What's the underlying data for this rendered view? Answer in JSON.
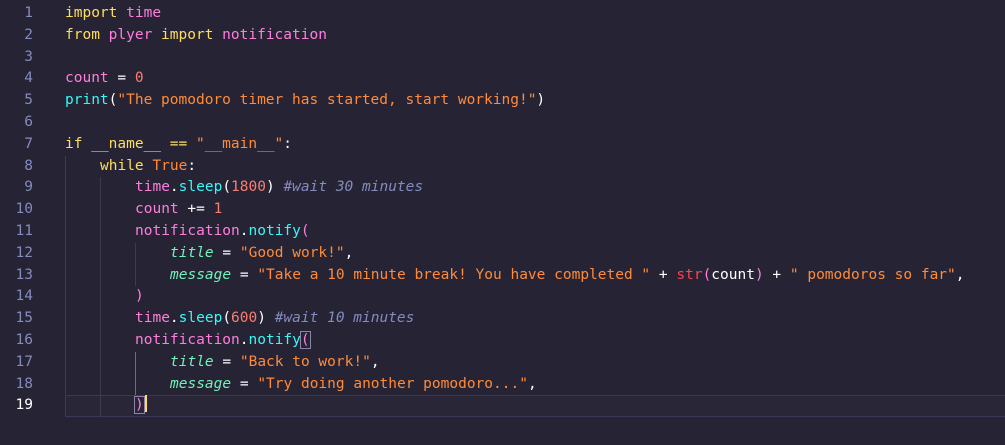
{
  "editor": {
    "lines": [
      {
        "n": "1",
        "tokens": {
          "a": "import",
          "b": "time"
        }
      },
      {
        "n": "2",
        "tokens": {
          "a": "from",
          "b": "plyer",
          "c": "import",
          "d": "notification"
        }
      },
      {
        "n": "3"
      },
      {
        "n": "4",
        "tokens": {
          "a": "count",
          "b": "=",
          "c": "0"
        }
      },
      {
        "n": "5",
        "tokens": {
          "a": "print",
          "b": "(",
          "c": "\"The pomodoro timer has started, start working!\"",
          "d": ")"
        }
      },
      {
        "n": "6"
      },
      {
        "n": "7",
        "tokens": {
          "a": "if",
          "b": "__name__",
          "c": "==",
          "d": "\"__main__\"",
          "e": ":"
        }
      },
      {
        "n": "8",
        "tokens": {
          "a": "while",
          "b": "True",
          "c": ":"
        }
      },
      {
        "n": "9",
        "tokens": {
          "a": "time",
          "b": ".",
          "c": "sleep",
          "d": "(",
          "e": "1800",
          "f": ")",
          "g": "#wait 30 minutes"
        }
      },
      {
        "n": "10",
        "tokens": {
          "a": "count",
          "b": "+=",
          "c": "1"
        }
      },
      {
        "n": "11",
        "tokens": {
          "a": "notification",
          "b": ".",
          "c": "notify",
          "d": "("
        }
      },
      {
        "n": "12",
        "tokens": {
          "a": "title",
          "b": "=",
          "c": "\"Good work!\"",
          "d": ","
        }
      },
      {
        "n": "13",
        "tokens": {
          "a": "message",
          "b": "=",
          "c": "\"Take a 10 minute break! You have completed \"",
          "d": "+",
          "e": "str",
          "f": "(",
          "g": "count",
          "h": ")",
          "i": "+",
          "j": "\" pomodoros so far\"",
          "k": ","
        }
      },
      {
        "n": "14",
        "tokens": {
          "a": ")"
        }
      },
      {
        "n": "15",
        "tokens": {
          "a": "time",
          "b": ".",
          "c": "sleep",
          "d": "(",
          "e": "600",
          "f": ")",
          "g": "#wait 10 minutes"
        }
      },
      {
        "n": "16",
        "tokens": {
          "a": "notification",
          "b": ".",
          "c": "notify",
          "d": "("
        }
      },
      {
        "n": "17",
        "tokens": {
          "a": "title",
          "b": "=",
          "c": "\"Back to work!\"",
          "d": ","
        }
      },
      {
        "n": "18",
        "tokens": {
          "a": "message",
          "b": "=",
          "c": "\"Try doing another pomodoro...\"",
          "d": ","
        }
      },
      {
        "n": "19",
        "tokens": {
          "a": ")"
        }
      }
    ]
  },
  "theme": {
    "background": "#262335",
    "line_number": "#848bbd",
    "keyword": "#fede5d",
    "string": "#ff8b39",
    "function": "#36f9f6",
    "variable": "#ff7edb",
    "comment": "#848bbd",
    "parameter": "#72f1b8",
    "cursor": "#fede5d"
  }
}
